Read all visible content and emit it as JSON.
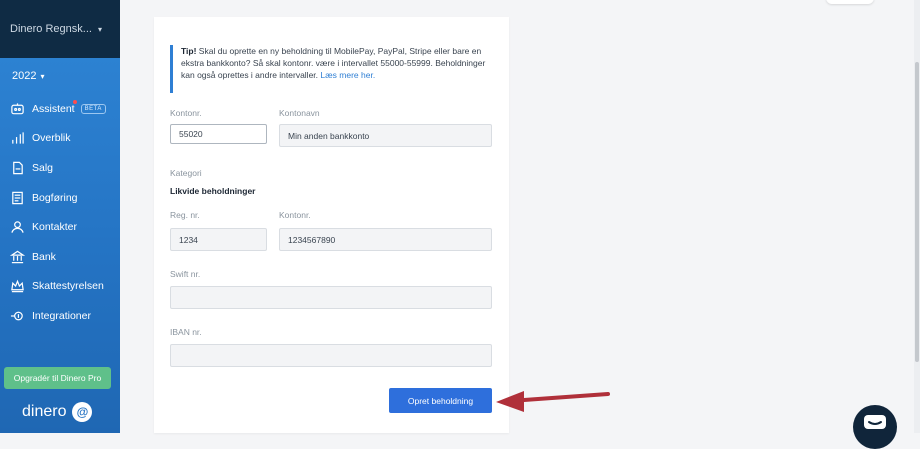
{
  "sidebar": {
    "org_name": "Dinero Regnsk...",
    "year": "2022",
    "items": [
      {
        "label": "Assistent",
        "badge": "BETA",
        "icon": "robot-icon"
      },
      {
        "label": "Overblik",
        "icon": "bar-chart-icon"
      },
      {
        "label": "Salg",
        "icon": "document-icon"
      },
      {
        "label": "Bogføring",
        "icon": "ledger-icon"
      },
      {
        "label": "Kontakter",
        "icon": "person-icon"
      },
      {
        "label": "Bank",
        "icon": "bank-icon"
      },
      {
        "label": "Skattestyrelsen",
        "icon": "crown-icon"
      },
      {
        "label": "Integrationer",
        "icon": "plug-icon"
      }
    ],
    "upgrade_label": "Opgradér til Dinero Pro",
    "logo_text": "dinero"
  },
  "form": {
    "tip_bold": "Tip!",
    "tip_text": " Skal du oprette en ny beholdning til MobilePay, PayPal, Stripe eller bare en ekstra bankkonto? Så skal kontonr. være i intervallet 55000-55999. Beholdninger kan også oprettes i andre intervaller. ",
    "tip_link": "Læs mere her.",
    "kontonr_label": "Kontonr.",
    "kontonr_value": "55020",
    "kontonavn_label": "Kontonavn",
    "kontonavn_value": "Min anden bankkonto",
    "kategori_label": "Kategori",
    "kategori_value": "Likvide beholdninger",
    "regnr_label": "Reg. nr.",
    "regnr_value": "1234",
    "bank_kontonr_label": "Kontonr.",
    "bank_kontonr_value": "1234567890",
    "swift_label": "Swift nr.",
    "swift_value": "",
    "iban_label": "IBAN nr.",
    "iban_value": "",
    "submit_label": "Opret beholdning"
  },
  "colors": {
    "sidebar": "#2473c3",
    "accent": "#2e6fdc",
    "upgrade": "#5fc08a",
    "arrow": "#b0303a"
  }
}
